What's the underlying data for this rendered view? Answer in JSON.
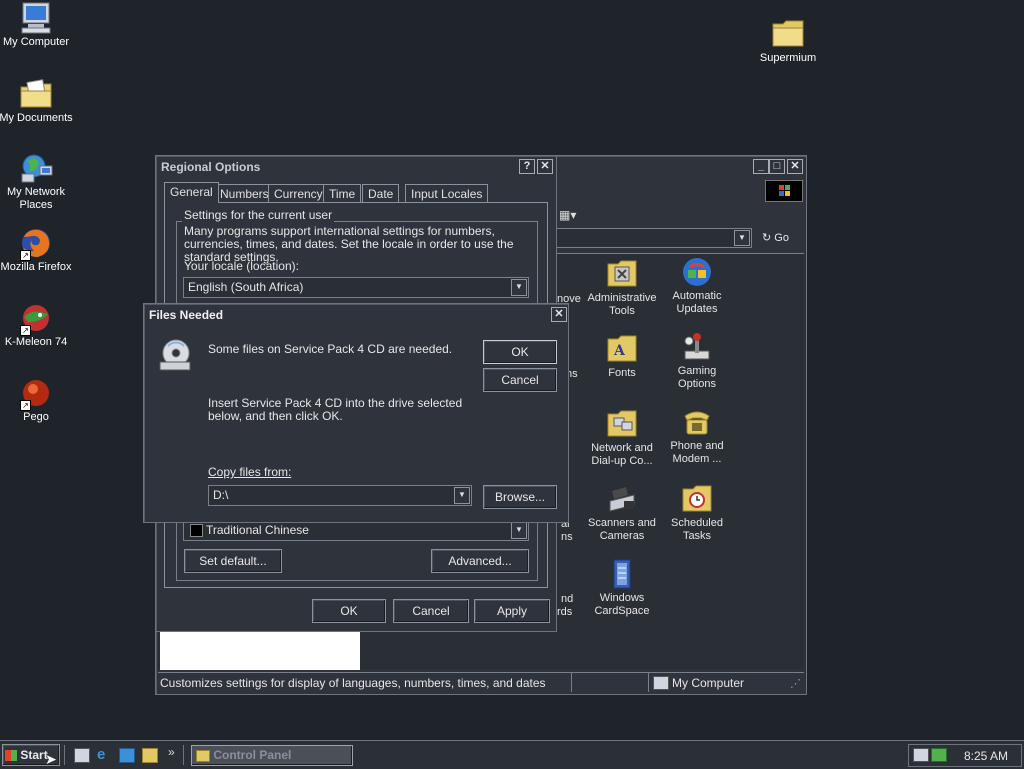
{
  "desktop": {
    "icons": [
      {
        "label": "My Computer"
      },
      {
        "label": "My Documents"
      },
      {
        "label": "My Network Places"
      },
      {
        "label": "Mozilla Firefox"
      },
      {
        "label": "K-Meleon 74"
      },
      {
        "label": "Pego"
      },
      {
        "label": "Supermium"
      }
    ]
  },
  "control_panel": {
    "go_label": "Go",
    "status_text": "Customizes settings for display of languages, numbers, times, and dates",
    "status_location": "My Computer",
    "icons": [
      {
        "label": "Administrative Tools"
      },
      {
        "label": "Automatic Updates"
      },
      {
        "label": "Fonts"
      },
      {
        "label": "Gaming Options"
      },
      {
        "label": "Network and Dial-up Co..."
      },
      {
        "label": "Phone and Modem ..."
      },
      {
        "label": "Scanners and Cameras"
      },
      {
        "label": "Scheduled Tasks"
      },
      {
        "label": "Windows CardSpace"
      }
    ],
    "partial_labels": [
      "nove",
      "ns",
      "ns",
      "al",
      "ns",
      "nd",
      "rds"
    ]
  },
  "regional": {
    "title": "Regional Options",
    "tabs": [
      "General",
      "Numbers",
      "Currency",
      "Time",
      "Date",
      "Input Locales"
    ],
    "group_title": "Settings for the current user",
    "description": "Many programs support international settings for numbers, currencies, times, and dates. Set the locale in order to use the standard settings.",
    "locale_label": "Your locale (location):",
    "locale_value": "English (South Africa)",
    "lang_item": "Traditional Chinese",
    "set_default": "Set default...",
    "advanced": "Advanced...",
    "ok": "OK",
    "cancel": "Cancel",
    "apply": "Apply"
  },
  "files_needed": {
    "title": "Files Needed",
    "message": "Some files on Service Pack 4 CD are needed.",
    "instruction": "Insert Service Pack 4 CD into the drive selected below, and then click OK.",
    "copy_from_label": "Copy files from:",
    "copy_from_value": "D:\\",
    "ok": "OK",
    "cancel": "Cancel",
    "browse": "Browse..."
  },
  "taskbar": {
    "start": "Start",
    "task": "Control Panel",
    "time": "8:25 AM",
    "chevron": "»"
  }
}
